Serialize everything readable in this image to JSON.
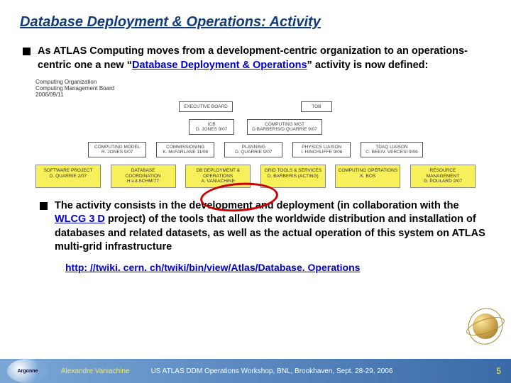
{
  "title": "Database Deployment & Operations: Activity",
  "bullet1_pre": "As ATLAS Computing moves from a development-centric organization to an operations-centric one a new “",
  "bullet1_link": "Database Deployment & Operations",
  "bullet1_post": "” activity is now defined:",
  "org": {
    "header_l1": "Computing Organization",
    "header_l2": "Computing Management Board",
    "header_l3": "2006/09/11",
    "exec_board": "EXECUTIVE BOARD",
    "tob": "TOB",
    "icb_l1": "ICB",
    "icb_l2": "D. JONES 9/07",
    "cmgt_l1": "COMPUTING MGT",
    "cmgt_l2": "D.BARBERIS/D.QUARRIE 9/07",
    "row3": [
      {
        "l1": "COMPUTING MODEL",
        "l2": "R. JONES 9/07"
      },
      {
        "l1": "COMMISSIONING",
        "l2": "K. McFARLANE 11/06"
      },
      {
        "l1": "PLANNING",
        "l2": "D. QUARRIE 9/07"
      },
      {
        "l1": "PHYSICS LIAISON",
        "l2": "I. HINCHLIFFE 9/06"
      },
      {
        "l1": "TDAQ LIAISON",
        "l2": "C. BEE/V. VERCESI 9/06"
      }
    ],
    "row4": [
      {
        "l1": "SOFTWARE PROJECT",
        "l2": "D. QUARRIE 2/07"
      },
      {
        "l1": "DATABASE COORDINATION",
        "l2": "H.v.d.SCHMITT"
      },
      {
        "l1": "DB DEPLOYMENT & OPERATIONS",
        "l2": "A. VANIACHINE"
      },
      {
        "l1": "GRID TOOLS & SERVICES",
        "l2": "D. BARBERIS (ACTING)"
      },
      {
        "l1": "COMPUTING OPERATIONS",
        "l2": "K. BOS"
      },
      {
        "l1": "RESOURCE MANAGEMENT",
        "l2": "G. POULARD 2/07"
      }
    ]
  },
  "bullet2_pre": "The activity consists in the development and deployment (in collaboration with the ",
  "bullet2_link": "WLCG 3 D",
  "bullet2_post": " project) of the tools that allow the worldwide distribution and installation of databases and related datasets, as well as the actual operation of this system on ATLAS multi-grid infrastructure",
  "url": "http: //twiki. cern. ch/twiki/bin/view/Atlas/Database. Operations",
  "footer": {
    "logo": "Argonne",
    "author": "Alexandre Vaniachine",
    "event": "US ATLAS DDM Operations Workshop, BNL, Brookhaven, Sept. 28-29, 2006",
    "page": "5"
  }
}
